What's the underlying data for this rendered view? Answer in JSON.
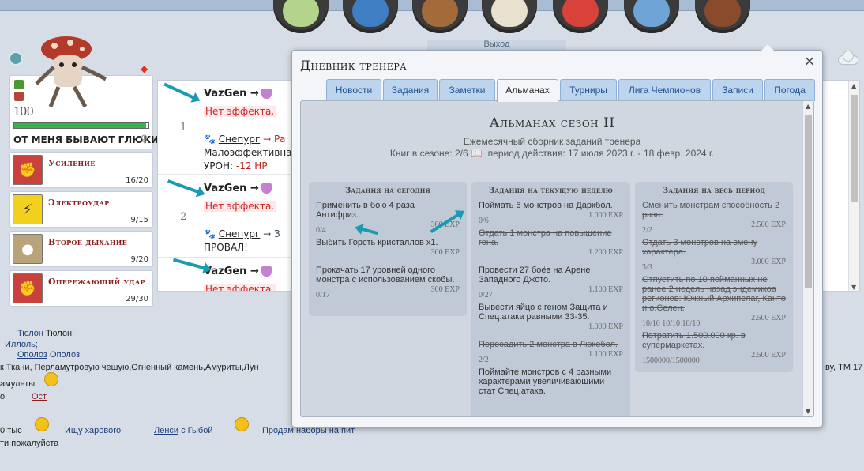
{
  "topnav": {
    "icons": [
      "trainer-icon",
      "pokeball-icon",
      "backpack-icon",
      "mail-icon",
      "pokedex-icon",
      "settings-icon",
      "diary-icon"
    ],
    "exit_label": "Выход"
  },
  "monster": {
    "level": "100",
    "name": "ОТ МЕНЯ БЫВАЮТ ГЛЮКИ",
    "hp_fraction": 0.98,
    "gender_symbol": "♀"
  },
  "moves": [
    {
      "name": "Усиление",
      "pp": "16/20",
      "type_icon": "fight-icon"
    },
    {
      "name": "Электроудар",
      "pp": "9/15",
      "type_icon": "electric-icon"
    },
    {
      "name": "Второе дыхание",
      "pp": "9/20",
      "type_icon": "paw-icon"
    },
    {
      "name": "Опережающий удар",
      "pp": "29/30",
      "type_icon": "fight-icon"
    }
  ],
  "battle_log": [
    {
      "turn": "1",
      "attacker": "VazGen →",
      "result": "Нет эффекта.",
      "target": "Снепург",
      "target_tail": "→ Ра",
      "line2": "Малоэффективная",
      "line3_label": "УРОН:",
      "line3_value": "-12 HP"
    },
    {
      "turn": "2",
      "attacker": "VazGen →",
      "result": "Нет эффекта.",
      "target": "Снепург",
      "target_tail": "→ З",
      "line2": "ПРОВАЛ!"
    },
    {
      "turn": "",
      "attacker": "VazGen →",
      "result": "Нет эффекта."
    }
  ],
  "chat": {
    "l1a": "Тюлон",
    "l1b": "Тюлон;",
    "l2a": "Иллоль;",
    "l3a": "Ополоз",
    "l3b": "Ополоз.",
    "l4": "к Ткани, Перламутровую чешую,Огненный камень,Амуриты,Лун",
    "l4_right": "ву, ТМ 17",
    "l5": "амулеты",
    "l6a": "о",
    "l6b": "Ост",
    "l7a": "0 тыс",
    "l7b": "Ищу харового",
    "l7c": "Ленси",
    "l7d": "с Гыбой",
    "l7e": "Продам наборы на пит",
    "l8": "ти пожалуйста"
  },
  "modal": {
    "title": "Дневник тренера",
    "close": "×",
    "tabs": [
      "Новости",
      "Задания",
      "Заметки",
      "Альманах",
      "Турниры",
      "Лига Чемпионов",
      "Записи",
      "Погода"
    ],
    "active_tab": "Альманах",
    "almanac": {
      "title": "Альманах сезон II",
      "subtitle": "Ежемесячный сборник заданий тренера",
      "books": "Книг в сезоне: 2/6",
      "period": "период действия: 17 июля 2023 г. - 18 февр. 2024 г."
    },
    "columns": [
      {
        "head": "Задания на сегодня",
        "tasks": [
          {
            "text": "Применить в бою 4 раза Антифриз.",
            "progress": "0/4",
            "exp": "300 EXP",
            "done": false
          },
          {
            "text": "Выбить Горсть кристаллов х1.",
            "progress": "",
            "exp": "300 EXP",
            "done": false
          },
          {
            "text": "Прокачать 17 уровней одного монстра с использованием скобы.",
            "progress": "0/17",
            "exp": "300 EXP",
            "done": false
          }
        ]
      },
      {
        "head": "Задания на текущую неделю",
        "tasks": [
          {
            "text": "Поймать 6 монстров на Даркбол.",
            "progress": "0/6",
            "exp": "1.000 EXP",
            "done": false
          },
          {
            "text": "Отдать 1 монстра на повышение гена.",
            "progress": "",
            "exp": "1.200 EXP",
            "done": true
          },
          {
            "text": "Провести 27 боёв на Арене Западного Джото.",
            "progress": "0/27",
            "exp": "1.100 EXP",
            "done": false
          },
          {
            "text": "Вывести яйцо с геном Защита и Спец.атака равными 33-35.",
            "progress": "",
            "exp": "1.000 EXP",
            "done": false
          },
          {
            "text": "Пересадить 2 монстра в Люкебол.",
            "progress": "2/2",
            "exp": "1.100 EXP",
            "done": true
          },
          {
            "text": "Поймайте монстров с 4 разными характерами увеличивающими стат Спец.атака.",
            "progress": "",
            "exp": "",
            "done": false
          }
        ]
      },
      {
        "head": "Задания на весь период",
        "tasks": [
          {
            "text": "Сменить монстрам способность 2 раза.",
            "progress": "2/2",
            "exp": "2.500 EXP",
            "done": true
          },
          {
            "text": "Отдать 3 монстров на смену характера.",
            "progress": "3/3",
            "exp": "3.000 EXP",
            "done": true
          },
          {
            "text": "Отпустить по 10 пойманных не ранее 2 недель назад эндемиков регионов: Южный Архипелаг, Канто и о.Селен.",
            "progress": "10/10 10/10 10/10",
            "exp": "2.500 EXP",
            "done": true
          },
          {
            "text": "Потратить 1.500.000 кр. в супермаркетах.",
            "progress": "1500000/1500000",
            "exp": "2.500 EXP",
            "done": true
          }
        ]
      }
    ]
  }
}
